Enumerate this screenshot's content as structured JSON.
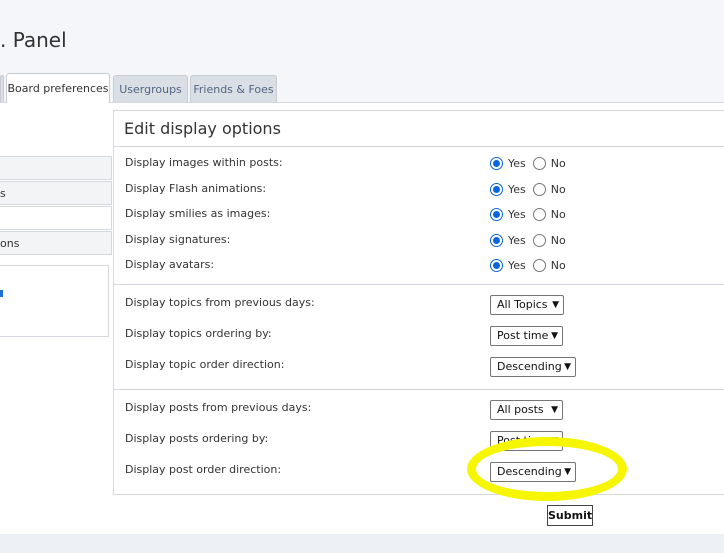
{
  "header": {
    "title_fragment": ". Panel"
  },
  "tabs": [
    {
      "label": "Board preferences",
      "active": true
    },
    {
      "label": "Usergroups",
      "active": false
    },
    {
      "label": "Friends & Foes",
      "active": false
    }
  ],
  "sidebar": {
    "items": [
      {
        "label": "s"
      },
      {
        "label": ""
      },
      {
        "label": "ons"
      }
    ]
  },
  "section": {
    "title": "Edit display options",
    "yes_label": "Yes",
    "no_label": "No",
    "radio_rows": [
      {
        "label": "Display images within posts:",
        "value": "Yes"
      },
      {
        "label": "Display Flash animations:",
        "value": "Yes"
      },
      {
        "label": "Display smilies as images:",
        "value": "Yes"
      },
      {
        "label": "Display signatures:",
        "value": "Yes"
      },
      {
        "label": "Display avatars:",
        "value": "Yes"
      }
    ],
    "topic_rows": [
      {
        "label": "Display topics from previous days:",
        "value": "All Topics"
      },
      {
        "label": "Display topics ordering by:",
        "value": "Post time"
      },
      {
        "label": "Display topic order direction:",
        "value": "Descending"
      }
    ],
    "post_rows": [
      {
        "label": "Display posts from previous days:",
        "value": "All posts"
      },
      {
        "label": "Display posts ordering by:",
        "value": "Post time"
      },
      {
        "label": "Display post order direction:",
        "value": "Descending"
      }
    ]
  },
  "submit_label": "Submit",
  "colors": {
    "highlight": "#f6f600",
    "radio_checked": "#0a66d9",
    "tab_text": "#536482"
  },
  "icons": {
    "select_arrow": "chevron-down-icon"
  }
}
